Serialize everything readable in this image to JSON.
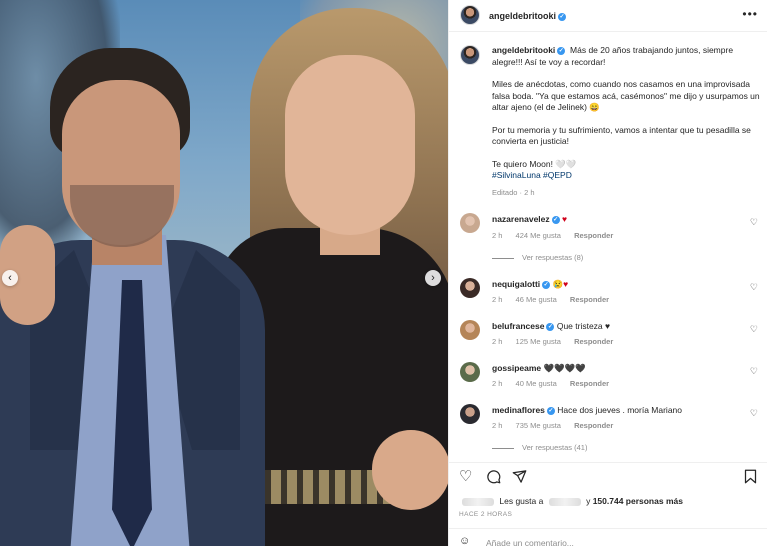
{
  "post": {
    "username": "angeldebritooki",
    "caption_paragraphs": [
      "Más de 20 años trabajando juntos, siempre alegre!!! Así te voy a recordar!",
      "Miles de anécdotas, como cuando nos casamos en una improvisada falsa boda. \"Ya que estamos acá, casémonos\" me dijo y usurpamos un altar ajeno (el de Jelinek) 😄",
      "Por tu memoria y tu sufrimiento, vamos a intentar que tu pesadilla se convierta en justicia!"
    ],
    "caption_last": "Te quiero Moon! 🤍🤍",
    "hashtags": "#SilvinaLuna #QEPD",
    "edited": "Editado · 2 h",
    "more_icon": "more-horizontal-icon"
  },
  "comments": [
    {
      "user": "nazarenavelez",
      "verified": true,
      "text": "♥",
      "time": "2 h",
      "likes": "424 Me gusta",
      "reply": "Responder",
      "replies": "Ver respuestas (8)"
    },
    {
      "user": "nequigalotti",
      "verified": true,
      "text": "😢♥",
      "time": "2 h",
      "likes": "46 Me gusta",
      "reply": "Responder",
      "replies": ""
    },
    {
      "user": "belufrancese",
      "verified": true,
      "text": "Que tristeza ♥",
      "time": "2 h",
      "likes": "125 Me gusta",
      "reply": "Responder",
      "replies": ""
    },
    {
      "user": "gossipeame",
      "verified": false,
      "text": "🖤🖤🖤🖤",
      "time": "2 h",
      "likes": "40 Me gusta",
      "reply": "Responder",
      "replies": ""
    },
    {
      "user": "medinaflores",
      "verified": true,
      "text": "Hace dos jueves . moría Mariano",
      "time": "2 h",
      "likes": "735 Me gusta",
      "reply": "Responder",
      "replies": "Ver respuestas (41)"
    }
  ],
  "likes": {
    "prefix": "Les gusta a",
    "middle": "y",
    "count": "150.744 personas más"
  },
  "time_ago": "HACE 2 HORAS",
  "add_comment_placeholder": "Añade un comentario...",
  "icons": {
    "heart": "heart-icon",
    "comment": "comment-icon",
    "share": "share-icon",
    "save": "bookmark-icon",
    "emoji": "emoji-icon",
    "prev": "chevron-left-icon",
    "next": "chevron-right-icon"
  }
}
